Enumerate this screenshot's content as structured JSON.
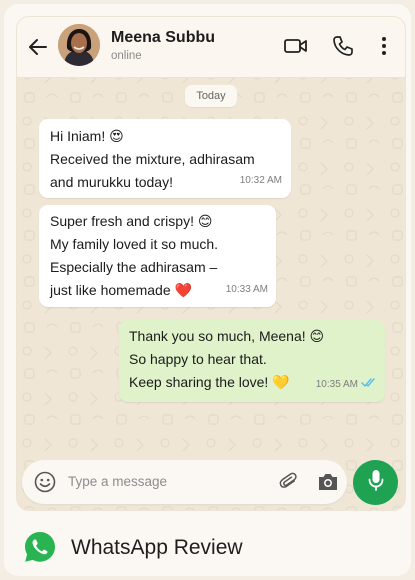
{
  "contact": {
    "name": "Meena Subbu",
    "status": "online"
  },
  "header_icons": [
    "back-arrow-icon",
    "video-call-icon",
    "voice-call-icon",
    "more-options-icon"
  ],
  "date_separator": "Today",
  "messages": [
    {
      "direction": "incoming",
      "lines": [
        "Hi Iniam! 😍",
        "Received the mixture, adhirasam",
        "and murukku today!"
      ],
      "time": "10:32 AM"
    },
    {
      "direction": "incoming",
      "lines": [
        "Super fresh and crispy! 😊",
        "My family loved it so much.",
        "Especially the adhirasam –",
        "just like homemade ❤️"
      ],
      "time": "10:33 AM"
    },
    {
      "direction": "outgoing",
      "lines": [
        "Thank you so much, Meena! 😊",
        "So happy to hear that.",
        "Keep sharing the love! 💛"
      ],
      "time": "10:35 AM",
      "read_receipt": "double-check-read"
    }
  ],
  "composer": {
    "placeholder": "Type a message",
    "icons": [
      "emoji-icon",
      "attach-icon",
      "camera-icon",
      "mic-icon"
    ]
  },
  "footer": {
    "title": "WhatsApp Review"
  },
  "colors": {
    "accent_green": "#1fa353",
    "outgoing_bubble": "#dff2c9",
    "incoming_bubble": "#ffffff",
    "chat_wallpaper": "#efe6d6",
    "read_ticks": "#53bdeb"
  }
}
